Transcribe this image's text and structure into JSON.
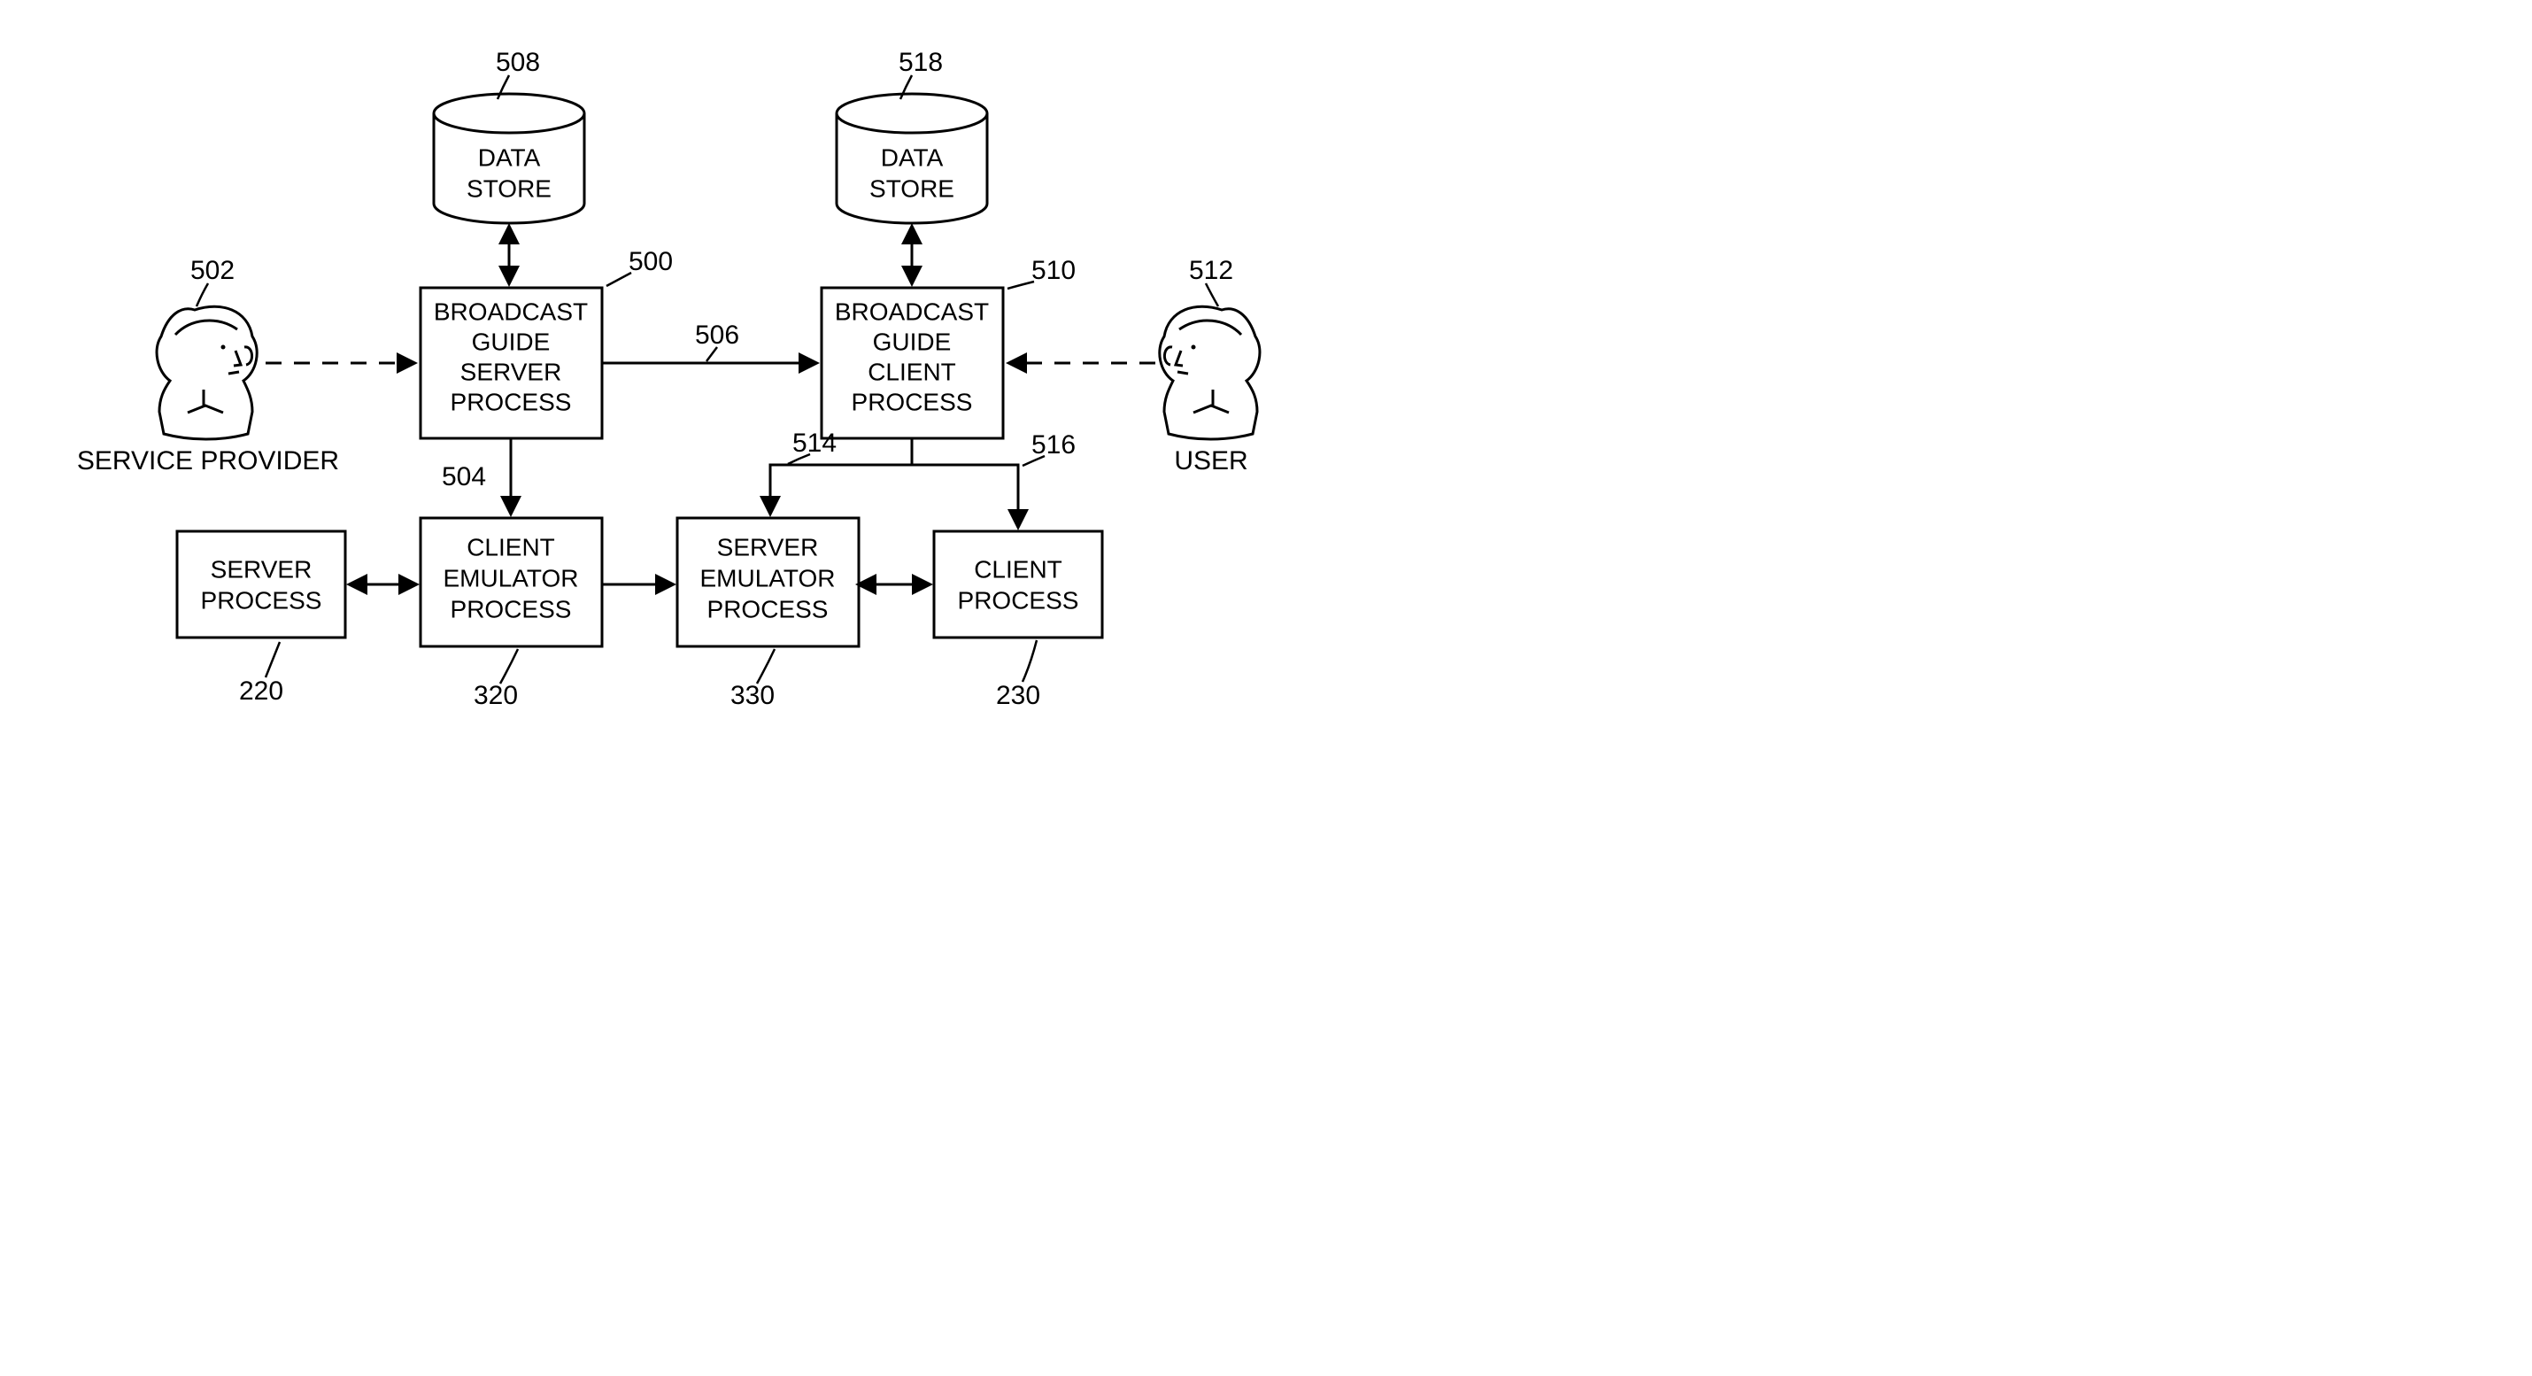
{
  "nodes": {
    "data_store_1": {
      "line1": "DATA",
      "line2": "STORE",
      "ref": "508"
    },
    "data_store_2": {
      "line1": "DATA",
      "line2": "STORE",
      "ref": "518"
    },
    "broadcast_server": {
      "l1": "BROADCAST",
      "l2": "GUIDE",
      "l3": "SERVER",
      "l4": "PROCESS",
      "ref": "500"
    },
    "broadcast_client": {
      "l1": "BROADCAST",
      "l2": "GUIDE",
      "l3": "CLIENT",
      "l4": "PROCESS",
      "ref": "510"
    },
    "server_process": {
      "l1": "SERVER",
      "l2": "PROCESS",
      "ref": "220"
    },
    "client_emulator": {
      "l1": "CLIENT",
      "l2": "EMULATOR",
      "l3": "PROCESS",
      "ref": "320"
    },
    "server_emulator": {
      "l1": "SERVER",
      "l2": "EMULATOR",
      "l3": "PROCESS",
      "ref": "330"
    },
    "client_process": {
      "l1": "CLIENT",
      "l2": "PROCESS",
      "ref": "230"
    },
    "service_provider": {
      "label": "SERVICE PROVIDER",
      "ref": "502"
    },
    "user": {
      "label": "USER",
      "ref": "512"
    }
  },
  "edges": {
    "bgs_to_ce": "504",
    "bgs_to_bgc": "506",
    "bgc_to_se": "514",
    "bgc_to_cp": "516"
  }
}
